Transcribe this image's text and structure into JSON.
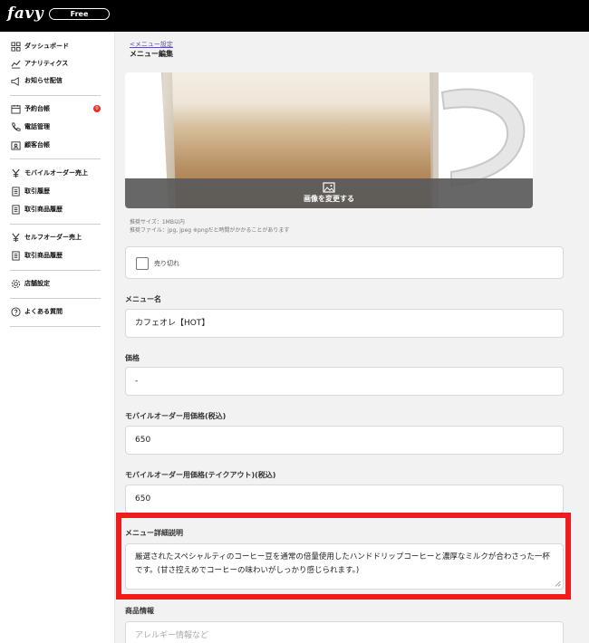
{
  "header": {
    "logo": "favy",
    "plan": "Free"
  },
  "sidebar": {
    "items": [
      {
        "label": "ダッシュボード",
        "icon": "grid-icon"
      },
      {
        "label": "アナリティクス",
        "icon": "analytics-icon"
      },
      {
        "label": "お知らせ配信",
        "icon": "megaphone-icon"
      },
      {
        "label": "予約台帳",
        "icon": "calendar-icon",
        "badge": "0"
      },
      {
        "label": "電話管理",
        "icon": "phone-icon"
      },
      {
        "label": "顧客台帳",
        "icon": "customer-book-icon"
      },
      {
        "label": "モバイルオーダー売上",
        "icon": "yen-icon"
      },
      {
        "label": "取引履歴",
        "icon": "document-icon"
      },
      {
        "label": "取引商品履歴",
        "icon": "document-icon"
      },
      {
        "label": "セルフオーダー売上",
        "icon": "yen-icon"
      },
      {
        "label": "取引商品履歴",
        "icon": "document-icon"
      },
      {
        "label": "店舗設定",
        "icon": "gear-icon"
      },
      {
        "label": "よくある質問",
        "icon": "question-icon"
      }
    ]
  },
  "main": {
    "breadcrumb": "<メニュー設定",
    "title": "メニュー編集",
    "image": {
      "change_label": "画像を変更する"
    },
    "hints": [
      "推奨サイズ：1MB以内",
      "推奨ファイル：jpg, jpeg ※pngだと時間がかかることがあります"
    ],
    "soldout_label": "売り切れ",
    "fields": {
      "menu_name": {
        "label": "メニュー名",
        "value": "カフェオレ【HOT】"
      },
      "price": {
        "label": "価格",
        "value": "-"
      },
      "mobile_price": {
        "label": "モバイルオーダー用価格(税込)",
        "value": "650"
      },
      "mobile_takeout_price": {
        "label": "モバイルオーダー用価格(テイクアウト)(税込)",
        "value": "650"
      },
      "description": {
        "label": "メニュー詳細説明",
        "value": "厳選されたスペシャルティのコーヒー豆を通常の倍量使用したハンドドリップコーヒーと濃厚なミルクが合わさった一杯です。(甘さ控えめでコーヒーの味わいがしっかり感じられます。)"
      },
      "product_info": {
        "label": "商品情報",
        "placeholder": "アレルギー情報など"
      }
    }
  },
  "colors": {
    "accent_link": "#5b4fa8",
    "highlight": "#ee1c1c",
    "badge": "#e8302a"
  }
}
